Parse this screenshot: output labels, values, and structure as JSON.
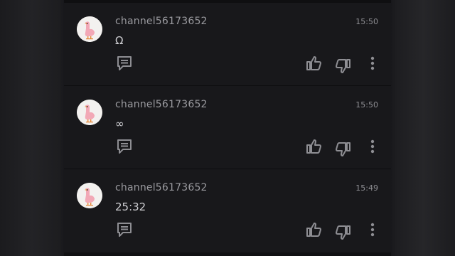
{
  "colors": {
    "background": "#18181b",
    "text": "#cfcfd3",
    "meta": "#9a9a9f",
    "icon": "#8e8e93"
  },
  "comments": [
    {
      "author": "channel56173652",
      "time": "15:50",
      "text": "Ω",
      "avatar": "goose-avatar",
      "actions": [
        "reply-icon",
        "thumbs-up-icon",
        "thumbs-down-icon",
        "more-vertical-icon"
      ]
    },
    {
      "author": "channel56173652",
      "time": "15:50",
      "text": "∞",
      "avatar": "goose-avatar",
      "actions": [
        "reply-icon",
        "thumbs-up-icon",
        "thumbs-down-icon",
        "more-vertical-icon"
      ]
    },
    {
      "author": "channel56173652",
      "time": "15:49",
      "text": "25:32",
      "avatar": "goose-avatar",
      "actions": [
        "reply-icon",
        "thumbs-up-icon",
        "thumbs-down-icon",
        "more-vertical-icon"
      ]
    }
  ]
}
